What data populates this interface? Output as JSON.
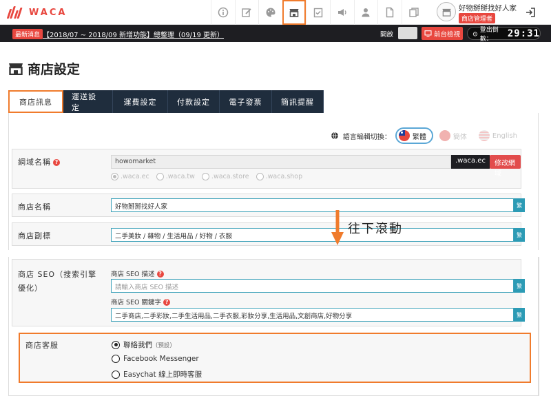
{
  "app": {
    "logo_text": "WACA"
  },
  "topbar": {
    "icons": [
      "info-icon",
      "edit-icon",
      "palette-icon",
      "store-icon",
      "checklist-icon",
      "megaphone-icon",
      "user-icon",
      "document-icon",
      "copy-icon"
    ],
    "active_icon": "store-icon",
    "shop_name": "好物掰掰找好人家",
    "shop_role": "商店管理者"
  },
  "announce": {
    "badge": "最新消息",
    "text": "【2018/07 ~ 2018/09 新增功能】總整理（09/19 更新）",
    "open_label": "開啟",
    "frontend_button": "前台檢視",
    "timer_label": "登出倒數：",
    "timer_value": "29:31"
  },
  "page": {
    "title": "商店設定"
  },
  "tabs": [
    {
      "label": "商店訊息",
      "active": true
    },
    {
      "label": "運送設定",
      "active": false
    },
    {
      "label": "運費設定",
      "active": false
    },
    {
      "label": "付款設定",
      "active": false
    },
    {
      "label": "電子發票",
      "active": false
    },
    {
      "label": "簡訊提醒",
      "active": false
    }
  ],
  "language": {
    "label": "語言編輯切換：",
    "options": [
      {
        "label": "繁體",
        "active": true
      },
      {
        "label": "簡体",
        "active": false
      },
      {
        "label": "English",
        "active": false
      }
    ]
  },
  "domain": {
    "label": "網域名稱",
    "value": "howomarket",
    "suffix": ".waca.ec",
    "modify_button": "修改網域",
    "options": [
      ".waca.ec",
      ".waca.tw",
      ".waca.store",
      ".waca.shop"
    ],
    "selected": ".waca.ec"
  },
  "shop_name": {
    "label": "商店名稱",
    "value": "好物掰掰找好人家",
    "add_button": "繁"
  },
  "shop_subtitle": {
    "label": "商店副標",
    "value": "二手美妝 / 雜物 / 生活用品 / 好物 / 衣服",
    "add_button": "繁"
  },
  "scroll_hint": {
    "text": "往下滾動"
  },
  "seo": {
    "label_line1": "商店 SEO（搜索引擎",
    "label_line2": "優化）",
    "desc_label": "商店 SEO 描述",
    "desc_placeholder": "請輸入商店 SEO 描述",
    "keywords_label": "商店 SEO 關鍵字",
    "keywords_value": "二手商店,二手彩妝,二手生活用品,二手衣服,彩妝分享,生活用品,文創商店,好物分享",
    "add_button": "繁"
  },
  "customer_service": {
    "label": "商店客服",
    "options": [
      {
        "label": "聯絡我們",
        "note": "(預設)",
        "checked": true
      },
      {
        "label": "Facebook Messenger",
        "note": "",
        "checked": false
      },
      {
        "label": "Easychat 線上即時客服",
        "note": "",
        "checked": false
      }
    ]
  },
  "colors": {
    "accent": "#f07b2c",
    "brand_red": "#e8473f",
    "navy": "#1f2d3d",
    "teal": "#2c9bb5"
  }
}
